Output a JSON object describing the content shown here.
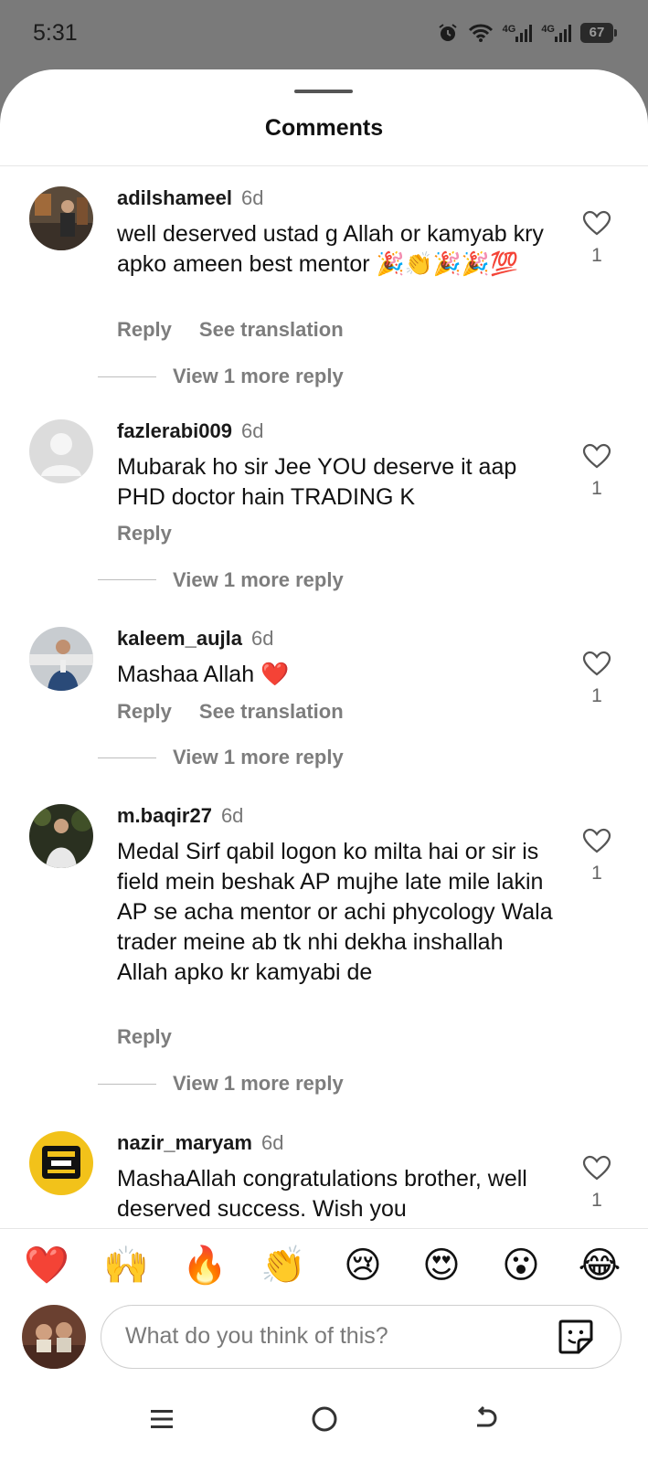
{
  "status_bar": {
    "time": "5:31",
    "network_1": "4G",
    "network_2": "4G",
    "battery": "67"
  },
  "sheet": {
    "title": "Comments"
  },
  "comments": [
    {
      "username": "adilshameel",
      "time": "6d",
      "text": "well deserved ustad g Allah or kamyab kry apko ameen best mentor 🎉👏🎉🎉💯",
      "actions": [
        "Reply",
        "See translation"
      ],
      "likes": "1",
      "more": "View 1 more reply"
    },
    {
      "username": "fazlerabi009",
      "time": "6d",
      "text": "Mubarak ho sir Jee YOU deserve it aap PHD doctor hain TRADING K",
      "actions": [
        "Reply"
      ],
      "likes": "1",
      "more": "View 1 more reply"
    },
    {
      "username": "kaleem_aujla",
      "time": "6d",
      "text": "Mashaa Allah ❤️",
      "actions": [
        "Reply",
        "See translation"
      ],
      "likes": "1",
      "more": "View 1 more reply"
    },
    {
      "username": "m.baqir27",
      "time": "6d",
      "text": "Medal Sirf qabil logon ko milta hai or sir is field mein beshak AP mujhe late mile lakin AP se acha mentor or achi phycology Wala trader meine ab tk nhi dekha inshallah Allah apko kr kamyabi de",
      "actions": [
        "Reply"
      ],
      "likes": "1",
      "more": "View 1 more reply"
    },
    {
      "username": "nazir_maryam",
      "time": "6d",
      "text": "MashaAllah congratulations brother, well deserved success. Wish you",
      "actions": [],
      "likes": "1",
      "more": ""
    }
  ],
  "reactions": [
    "❤️",
    "🙌",
    "🔥",
    "👏",
    "😢",
    "😍",
    "😮",
    "😂"
  ],
  "composer": {
    "placeholder": "What do you think of this?"
  },
  "icons": {
    "like": "heart-outline-icon",
    "sticker": "sticker-icon",
    "nav_recent": "menu-lines-icon",
    "nav_home": "circle-home-icon",
    "nav_back": "back-arrow-icon"
  }
}
